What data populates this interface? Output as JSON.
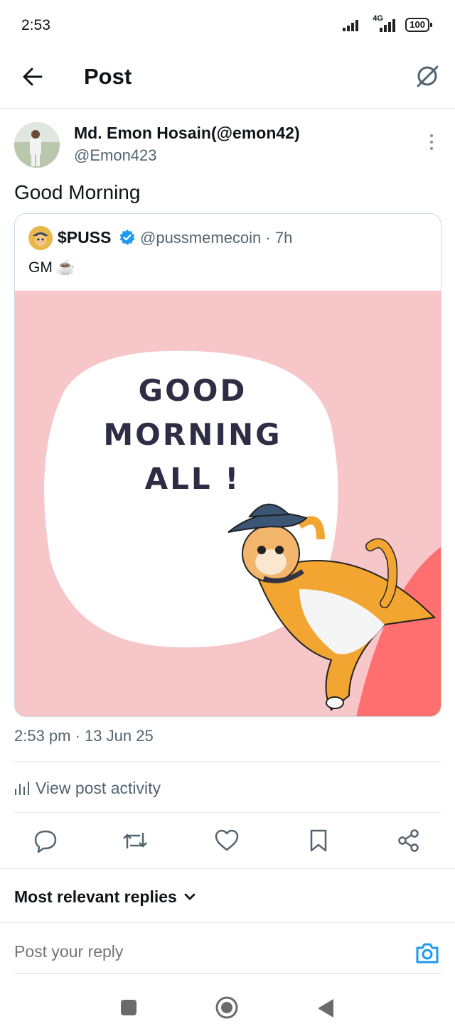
{
  "status_bar": {
    "time": "2:53",
    "network": "4G",
    "battery": "100"
  },
  "header": {
    "title": "Post"
  },
  "post": {
    "author_name": "Md. Emon Hosain(@emon42)",
    "author_handle": "@Emon423",
    "text": "Good Morning",
    "timestamp": "2:53 pm · 13 Jun 25",
    "activity_label": "View post activity"
  },
  "quote": {
    "name": "$PUSS",
    "handle": "@pussmemecoin · 7h",
    "text": "GM ☕",
    "image_text": [
      "GOOD",
      "MORNING",
      "ALL !"
    ]
  },
  "replies": {
    "sort_label": "Most relevant replies"
  },
  "reply_box": {
    "placeholder": "Post your reply"
  },
  "colors": {
    "accent": "#1d9bf0",
    "muted": "#536471",
    "divider": "#e7e9ea"
  }
}
